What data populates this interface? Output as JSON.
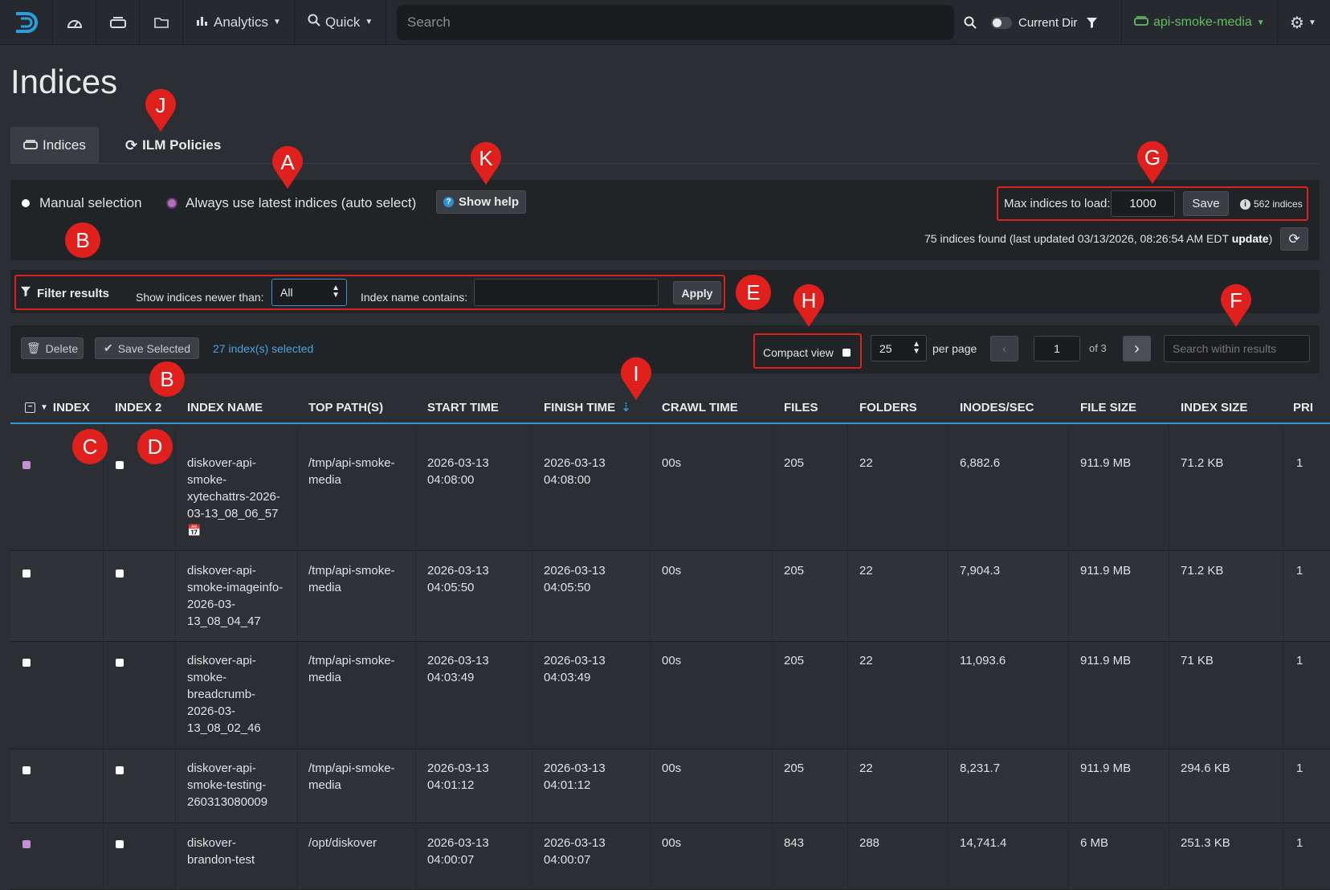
{
  "navbar": {
    "analytics_label": "Analytics",
    "quick_label": "Quick",
    "search_placeholder": "Search",
    "current_dir_label": "Current Dir",
    "index_label": "api-smoke-media"
  },
  "page": {
    "title": "Indices",
    "tabs": [
      {
        "label": "Indices"
      },
      {
        "label": "ILM Policies"
      }
    ]
  },
  "selection": {
    "manual_label": "Manual selection",
    "auto_label": "Always use latest indices (auto select)",
    "help_button": "Show help",
    "max_label": "Max indices to load:",
    "max_value": "1000",
    "save_label": "Save",
    "count_badge": "562 indices",
    "found_text": "75 indices found (last updated 03/13/2026, 08:26:54 AM EDT",
    "update_link": "update",
    "found_close": ")"
  },
  "filter": {
    "title": "Filter results",
    "newer_label": "Show indices newer than:",
    "newer_value": "All",
    "name_label": "Index name contains:",
    "name_value": "",
    "apply_label": "Apply"
  },
  "toolbar": {
    "delete_label": "Delete",
    "save_selected_label": "Save Selected",
    "selected_text": "27 index(s) selected",
    "compact_label": "Compact view",
    "per_page_value": "25",
    "per_page_label": "per page",
    "page_value": "1",
    "page_of": "of 3",
    "search_placeholder": "Search within results"
  },
  "annotations": {
    "A": "A",
    "B": "B",
    "C": "C",
    "D": "D",
    "E": "E",
    "F": "F",
    "G": "G",
    "H": "H",
    "I": "I",
    "J": "J",
    "K": "K"
  },
  "table": {
    "columns": [
      "INDEX",
      "INDEX 2",
      "INDEX NAME",
      "TOP PATH(S)",
      "START TIME",
      "FINISH TIME",
      "CRAWL TIME",
      "FILES",
      "FOLDERS",
      "INODES/SEC",
      "FILE SIZE",
      "INDEX SIZE",
      "PRI"
    ],
    "rows": [
      {
        "index_checked": true,
        "name": "diskover-api-smoke-xytechattrs-2026-03-13_08_06_57",
        "path": "/tmp/api-smoke-media",
        "start": "2026-03-13 04:08:00",
        "finish": "2026-03-13 04:08:00",
        "crawl": "00s",
        "files": "205",
        "folders": "22",
        "inodes": "6,882.6",
        "file_size": "911.9 MB",
        "index_size": "71.2 KB",
        "pri": "1"
      },
      {
        "index_checked": false,
        "name": "diskover-api-smoke-imageinfo-2026-03-13_08_04_47",
        "path": "/tmp/api-smoke-media",
        "start": "2026-03-13 04:05:50",
        "finish": "2026-03-13 04:05:50",
        "crawl": "00s",
        "files": "205",
        "folders": "22",
        "inodes": "7,904.3",
        "file_size": "911.9 MB",
        "index_size": "71.2 KB",
        "pri": "1"
      },
      {
        "index_checked": false,
        "name": "diskover-api-smoke-breadcrumb-2026-03-13_08_02_46",
        "path": "/tmp/api-smoke-media",
        "start": "2026-03-13 04:03:49",
        "finish": "2026-03-13 04:03:49",
        "crawl": "00s",
        "files": "205",
        "folders": "22",
        "inodes": "11,093.6",
        "file_size": "911.9 MB",
        "index_size": "71 KB",
        "pri": "1"
      },
      {
        "index_checked": false,
        "name": "diskover-api-smoke-testing-260313080009",
        "path": "/tmp/api-smoke-media",
        "start": "2026-03-13 04:01:12",
        "finish": "2026-03-13 04:01:12",
        "crawl": "00s",
        "files": "205",
        "folders": "22",
        "inodes": "8,231.7",
        "file_size": "911.9 MB",
        "index_size": "294.6 KB",
        "pri": "1"
      },
      {
        "index_checked": true,
        "name": "diskover-brandon-test",
        "path": "/opt/diskover",
        "start": "2026-03-13 04:00:07",
        "finish": "2026-03-13 04:00:07",
        "crawl": "00s",
        "files": "843",
        "folders": "288",
        "inodes": "14,741.4",
        "file_size": "6 MB",
        "index_size": "251.3 KB",
        "pri": "1"
      }
    ]
  },
  "colors": {
    "accent_blue": "#3596d4",
    "annotation_red": "#e0201d",
    "brand_green": "#5fbf5f",
    "selected_purple": "#c58fd6"
  }
}
